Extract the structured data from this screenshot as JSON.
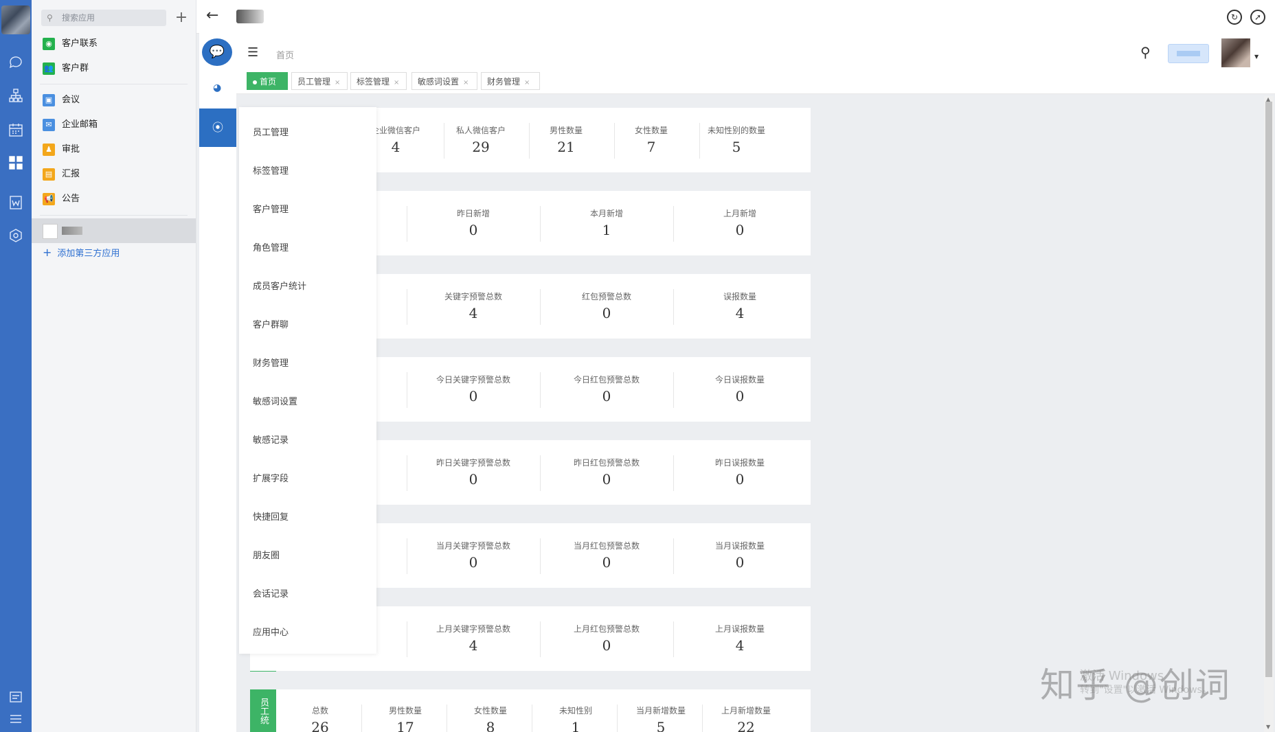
{
  "apps_pane": {
    "search_placeholder": "搜索应用",
    "items": [
      {
        "label": "客户联系",
        "color": "#23b14d",
        "icon": "chat-icon"
      },
      {
        "label": "客户群",
        "color": "#23b14d",
        "icon": "group-icon"
      },
      {
        "label": "会议",
        "color": "#4a8fe0",
        "icon": "meeting-icon"
      },
      {
        "label": "企业邮箱",
        "color": "#4a8fe0",
        "icon": "mail-icon"
      },
      {
        "label": "审批",
        "color": "#f3a71b",
        "icon": "approval-icon"
      },
      {
        "label": "汇报",
        "color": "#f3a71b",
        "icon": "report-icon"
      },
      {
        "label": "公告",
        "color": "#f3a71b",
        "icon": "announce-icon"
      }
    ],
    "add_third_party": "添加第三方应用"
  },
  "header": {
    "breadcrumb": "首页"
  },
  "tabs": [
    {
      "label": "首页",
      "home": true
    },
    {
      "label": "员工管理"
    },
    {
      "label": "标签管理"
    },
    {
      "label": "敏感词设置"
    },
    {
      "label": "财务管理"
    }
  ],
  "dropdown_menu": [
    "员工管理",
    "标签管理",
    "客户管理",
    "角色管理",
    "成员客户统计",
    "客户群聊",
    "财务管理",
    "敏感词设置",
    "敏感记录",
    "扩展字段",
    "快捷回复",
    "朋友圈",
    "会话记录",
    "应用中心"
  ],
  "cards": [
    {
      "stats": [
        {
          "label": "企业微信客户",
          "value": "4"
        },
        {
          "label": "私人微信客户",
          "value": "29"
        },
        {
          "label": "男性数量",
          "value": "21"
        },
        {
          "label": "女性数量",
          "value": "7"
        },
        {
          "label": "未知性别的数量",
          "value": "5"
        }
      ]
    },
    {
      "stats": [
        {
          "label": "昨日新增",
          "value": "0"
        },
        {
          "label": "本月新增",
          "value": "1"
        },
        {
          "label": "上月新增",
          "value": "0"
        }
      ]
    },
    {
      "stats": [
        {
          "label": "关键字预警总数",
          "value": "4"
        },
        {
          "label": "红包预警总数",
          "value": "0"
        },
        {
          "label": "误报数量",
          "value": "4"
        }
      ]
    },
    {
      "stats": [
        {
          "label": "今日关键字预警总数",
          "value": "0"
        },
        {
          "label": "今日红包预警总数",
          "value": "0"
        },
        {
          "label": "今日误报数量",
          "value": "0"
        }
      ]
    },
    {
      "stats": [
        {
          "label": "昨日关键字预警总数",
          "value": "0"
        },
        {
          "label": "昨日红包预警总数",
          "value": "0"
        },
        {
          "label": "昨日误报数量",
          "value": "0"
        }
      ]
    },
    {
      "stats": [
        {
          "label": "当月关键字预警总数",
          "value": "0"
        },
        {
          "label": "当月红包预警总数",
          "value": "0"
        },
        {
          "label": "当月误报数量",
          "value": "0"
        }
      ]
    },
    {
      "stats": [
        {
          "label": "上月关键字预警总数",
          "value": "4"
        },
        {
          "label": "上月红包预警总数",
          "value": "0"
        },
        {
          "label": "上月误报数量",
          "value": "4"
        }
      ]
    }
  ],
  "employee_card": {
    "tag": "员工统",
    "stats": [
      {
        "label": "总数",
        "value": "26"
      },
      {
        "label": "男性数量",
        "value": "17"
      },
      {
        "label": "女性数量",
        "value": "8"
      },
      {
        "label": "未知性别",
        "value": "1"
      },
      {
        "label": "当月新增数量",
        "value": "5"
      },
      {
        "label": "上月新增数量",
        "value": "22"
      }
    ]
  },
  "accent_color": "#3db466",
  "brand_blue": "#2c6fc2",
  "watermark": "知乎 @创词",
  "windows_activation": [
    "激活 Windows",
    "转到\"设置\"以激活 Windows。"
  ]
}
